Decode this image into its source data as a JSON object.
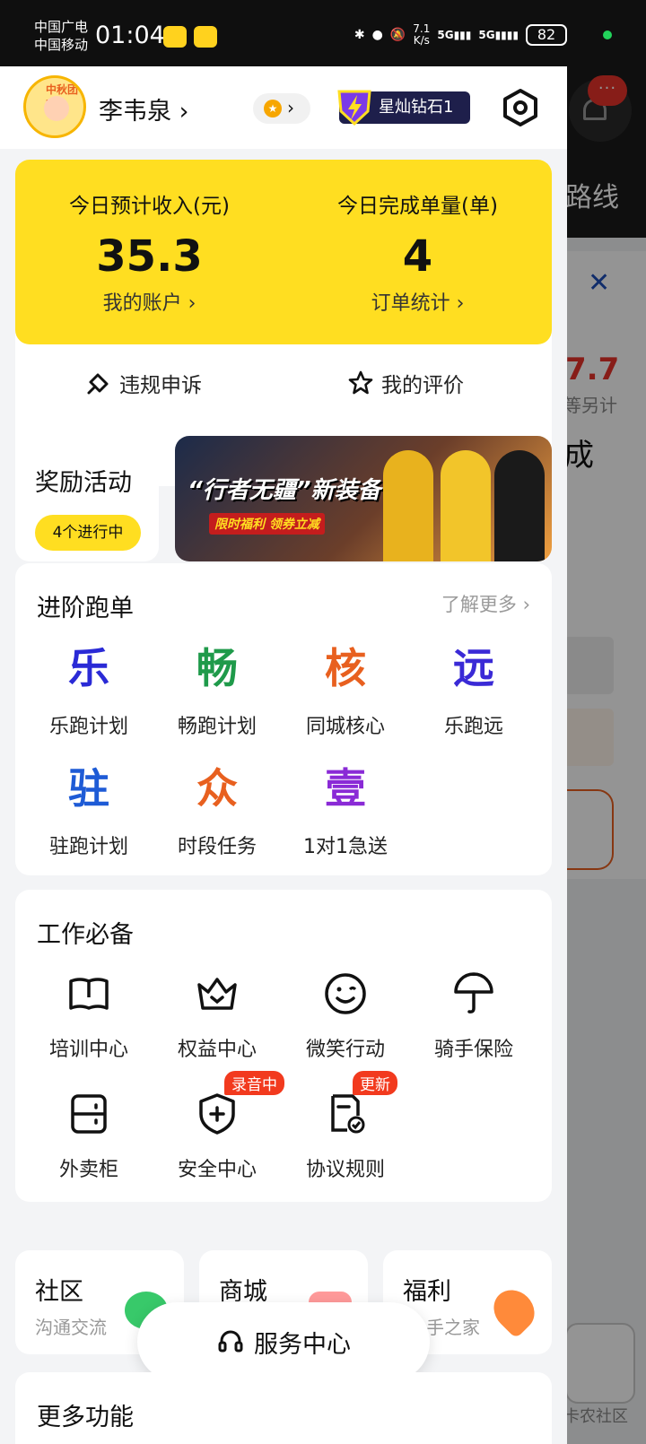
{
  "status_bar": {
    "carrier_1": "中国广电",
    "carrier_2": "中国移动",
    "time": "01:04",
    "net_speed_value": "7.1",
    "net_speed_unit": "K/s",
    "signal_1": "5G",
    "signal_2": "5G",
    "battery": "82"
  },
  "background_app": {
    "route_label": "路线",
    "price_partial": "7.7",
    "sub_partial": "等另计",
    "big_partial": "成",
    "bottom_label": "卡农社区",
    "msg_dots": "···"
  },
  "header": {
    "user_name": "李韦泉 ›",
    "level_arrow": "›",
    "rank_label": "星灿钻石1",
    "avatar_badge": "中秋团圆"
  },
  "income": {
    "left_label": "今日预计收入(元)",
    "left_value": "35.3",
    "left_link": "我的账户 ›",
    "right_label": "今日完成单量(单)",
    "right_value": "4",
    "right_link": "订单统计 ›",
    "appeal": "违规申诉",
    "reviews": "我的评价"
  },
  "reward": {
    "title": "奖励活动",
    "pill": "4个进行中",
    "banner_title": "“行者无疆”新装备",
    "banner_tag": "限时福利 领券立减"
  },
  "advanced": {
    "title": "进阶跑单",
    "more": "了解更多 ›",
    "items": [
      {
        "glyph": "乐",
        "label": "乐跑计划",
        "color": "#2a2ad6"
      },
      {
        "glyph": "畅",
        "label": "畅跑计划",
        "color": "#1f9a4a"
      },
      {
        "glyph": "核",
        "label": "同城核心",
        "color": "#e8601f"
      },
      {
        "glyph": "远",
        "label": "乐跑远",
        "color": "#3a2ad6"
      },
      {
        "glyph": "驻",
        "label": "驻跑计划",
        "color": "#1e5bd6"
      },
      {
        "glyph": "众",
        "label": "时段任务",
        "color": "#e8601f"
      },
      {
        "glyph": "壹",
        "label": "1对1急送",
        "color": "#8a2ad6"
      }
    ]
  },
  "tools": {
    "title": "工作必备",
    "items": [
      {
        "label": "培训中心",
        "icon": "book-icon"
      },
      {
        "label": "权益中心",
        "icon": "crown-icon"
      },
      {
        "label": "微笑行动",
        "icon": "smile-icon"
      },
      {
        "label": "骑手保险",
        "icon": "umbrella-icon"
      },
      {
        "label": "外卖柜",
        "icon": "locker-icon"
      },
      {
        "label": "安全中心",
        "icon": "shield-icon",
        "tag": "录音中"
      },
      {
        "label": "协议规则",
        "icon": "document-check-icon",
        "tag": "更新"
      }
    ]
  },
  "mini_cards": {
    "community": {
      "title": "社区",
      "sub": "沟通交流"
    },
    "mall": {
      "title": "商城"
    },
    "welfare": {
      "title": "福利",
      "sub": "手之家"
    }
  },
  "service_center": "服务中心",
  "more_functions": "更多功能",
  "colors": {
    "brand_yellow": "#ffde21",
    "tag_red": "#f23a1e",
    "rank_bg": "#1e1f4b"
  }
}
